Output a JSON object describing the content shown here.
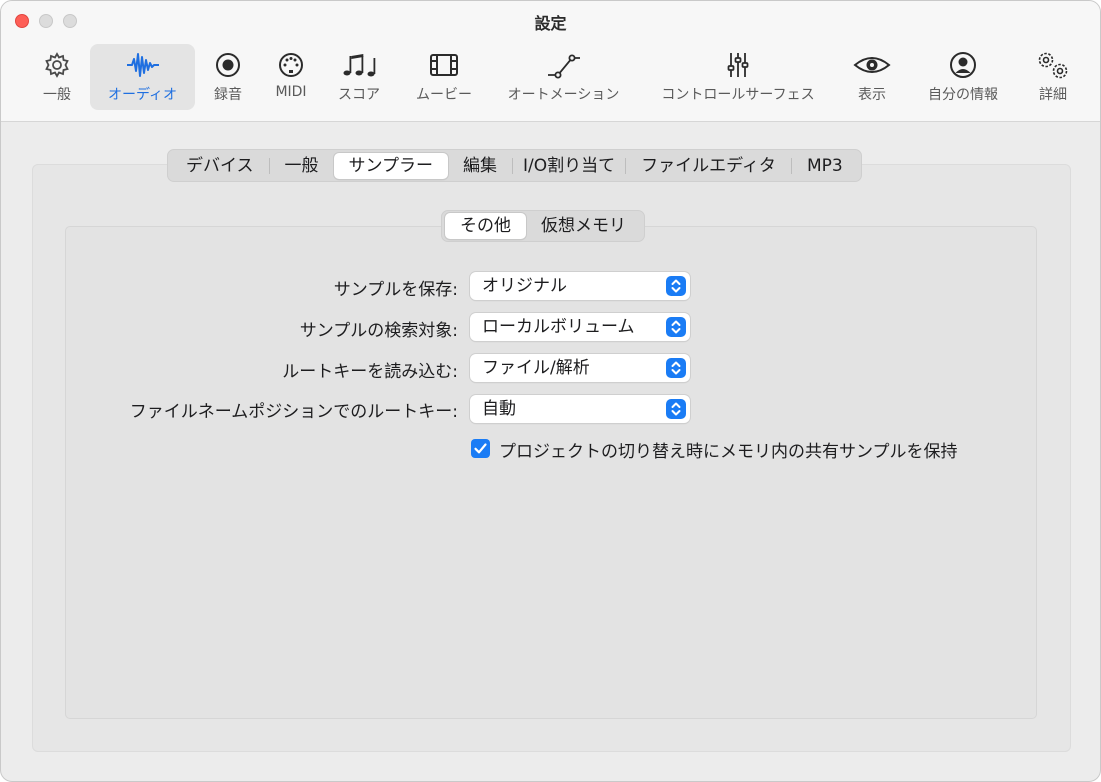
{
  "window": {
    "title": "設定"
  },
  "toolbar": {
    "items": [
      {
        "label": "一般",
        "icon": "gear-icon"
      },
      {
        "label": "オーディオ",
        "icon": "waveform-icon",
        "active": true
      },
      {
        "label": "録音",
        "icon": "record-icon"
      },
      {
        "label": "MIDI",
        "icon": "midi-port-icon"
      },
      {
        "label": "スコア",
        "icon": "music-notes-icon"
      },
      {
        "label": "ムービー",
        "icon": "film-icon"
      },
      {
        "label": "オートメーション",
        "icon": "automation-curve-icon"
      },
      {
        "label": "コントロールサーフェス",
        "icon": "sliders-icon"
      },
      {
        "label": "表示",
        "icon": "eye-icon"
      },
      {
        "label": "自分の情報",
        "icon": "person-icon"
      },
      {
        "label": "詳細",
        "icon": "gears-icon"
      }
    ]
  },
  "audio_tabs": {
    "items": [
      "デバイス",
      "一般",
      "サンプラー",
      "編集",
      "I/O割り当て",
      "ファイルエディタ",
      "MP3"
    ],
    "selected": "サンプラー"
  },
  "sub_tabs": {
    "items": [
      "その他",
      "仮想メモリ"
    ],
    "selected": "その他"
  },
  "settings": {
    "rows": [
      {
        "label": "サンプルを保存:",
        "value": "オリジナル"
      },
      {
        "label": "サンプルの検索対象:",
        "value": "ローカルボリューム"
      },
      {
        "label": "ルートキーを読み込む:",
        "value": "ファイル/解析"
      },
      {
        "label": "ファイルネームポジションでのルートキー:",
        "value": "自動"
      }
    ],
    "checkbox": {
      "label": "プロジェクトの切り替え時にメモリ内の共有サンプルを保持",
      "checked": true
    }
  },
  "colors": {
    "accent": "#1a7cf5",
    "close": "#fe5f57"
  }
}
